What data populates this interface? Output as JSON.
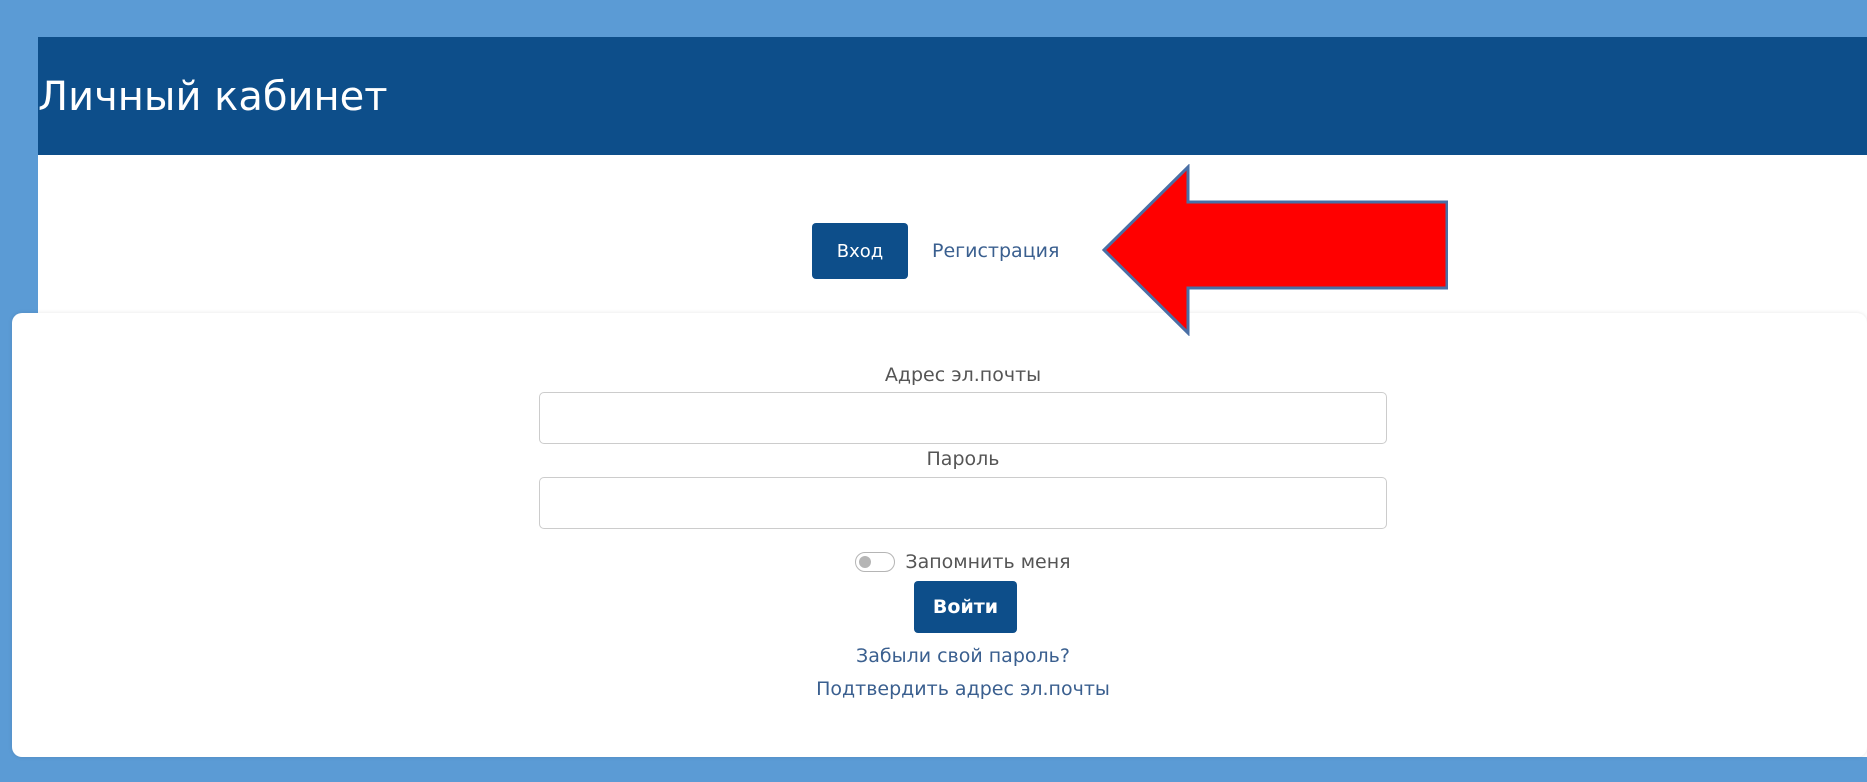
{
  "header": {
    "title": "Личный кабинет"
  },
  "tabs": {
    "login_label": "Вход",
    "register_label": "Регистрация"
  },
  "form": {
    "email": {
      "label": "Адрес эл.почты",
      "value": "",
      "placeholder": ""
    },
    "password": {
      "label": "Пароль",
      "value": "",
      "placeholder": ""
    },
    "remember": {
      "label": "Запомнить меня",
      "checked": false
    },
    "submit_label": "Войти",
    "forgot_link": "Забыли свой пароль?",
    "confirm_email_link": "Подтвердить адрес эл.почты"
  },
  "annotation": {
    "arrow_icon": "left-arrow-icon",
    "arrow_color": "#ff0000",
    "arrow_outline": "#4a6fa5"
  },
  "colors": {
    "outer_border": "#5b9bd5",
    "primary": "#0d4e8a",
    "link": "#3a5f8f",
    "text": "#555555"
  }
}
